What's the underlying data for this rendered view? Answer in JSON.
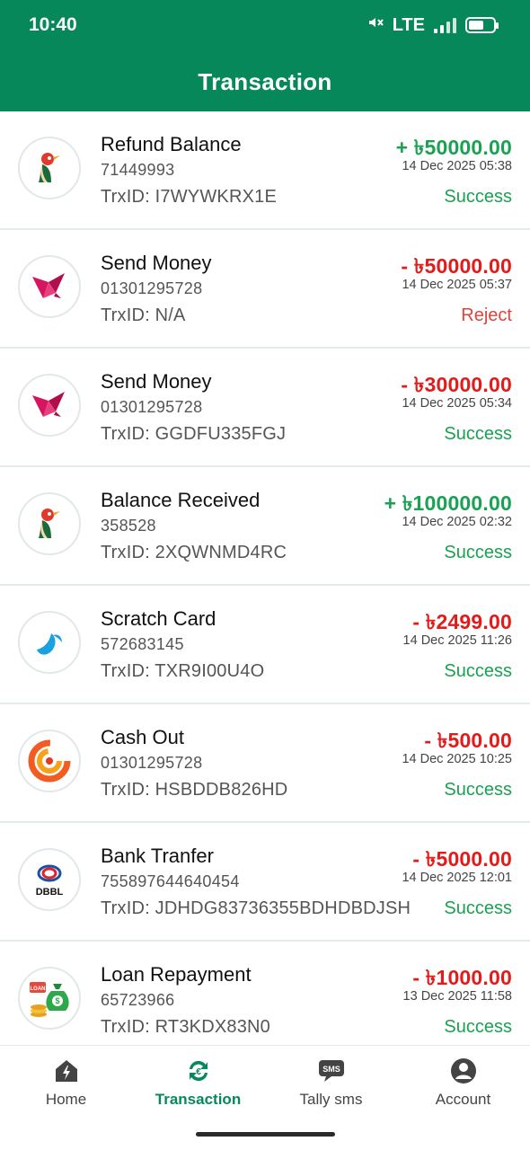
{
  "status_bar": {
    "time": "10:40",
    "network": "LTE"
  },
  "header": {
    "title": "Transaction"
  },
  "transactions": [
    {
      "title": "Refund Balance",
      "number": "71449993",
      "trx_id": "TrxID: I7WYWKRX1E",
      "amount": "+ ৳50000.00",
      "type": "credit",
      "date": "14 Dec 2025 05:38",
      "status": "Success",
      "status_type": "ok",
      "icon": "robi-bird-icon"
    },
    {
      "title": "Send Money",
      "number": "01301295728",
      "trx_id": "TrxID: N/A",
      "amount": "- ৳50000.00",
      "type": "debit",
      "date": "14 Dec 2025 05:37",
      "status": "Reject",
      "status_type": "bad",
      "icon": "bkash-bird-icon"
    },
    {
      "title": "Send Money",
      "number": "01301295728",
      "trx_id": "TrxID: GGDFU335FGJ",
      "amount": "- ৳30000.00",
      "type": "debit",
      "date": "14 Dec 2025 05:34",
      "status": "Success",
      "status_type": "ok",
      "icon": "bkash-bird-icon"
    },
    {
      "title": "Balance Received",
      "number": "358528",
      "trx_id": "TrxID: 2XQWNMD4RC",
      "amount": "+ ৳100000.00",
      "type": "credit",
      "date": "14 Dec 2025 02:32",
      "status": "Success",
      "status_type": "ok",
      "icon": "robi-bird-icon"
    },
    {
      "title": "Scratch Card",
      "number": "572683145",
      "trx_id": "TrxID: TXR9I00U4O",
      "amount": "- ৳2499.00",
      "type": "debit",
      "date": "14 Dec 2025 11:26",
      "status": "Success",
      "status_type": "ok",
      "icon": "grameenphone-icon"
    },
    {
      "title": "Cash Out",
      "number": "01301295728",
      "trx_id": "TrxID: HSBDDB826HD",
      "amount": "- ৳500.00",
      "type": "debit",
      "date": "14 Dec 2025 10:25",
      "status": "Success",
      "status_type": "ok",
      "icon": "nagad-icon"
    },
    {
      "title": "Bank Tranfer",
      "number": "755897644640454",
      "trx_id": "TrxID: JDHDG83736355BDHDBDJSH",
      "amount": "- ৳5000.00",
      "type": "debit",
      "date": "14 Dec 2025 12:01",
      "status": "Success",
      "status_type": "ok",
      "icon": "dbbl-bank-icon",
      "icon_text": "DBBL"
    },
    {
      "title": "Loan Repayment",
      "number": "65723966",
      "trx_id": "TrxID: RT3KDX83N0",
      "amount": "- ৳1000.00",
      "type": "debit",
      "date": "13 Dec 2025 11:58",
      "status": "Success",
      "status_type": "ok",
      "icon": "money-bag-icon",
      "icon_text": "LOAN"
    }
  ],
  "bottom_nav": [
    {
      "label": "Home",
      "icon": "home-icon",
      "active": false
    },
    {
      "label": "Transaction",
      "icon": "transaction-icon",
      "active": true
    },
    {
      "label": "Tally sms",
      "icon": "sms-icon",
      "icon_text": "SMS",
      "active": false
    },
    {
      "label": "Account",
      "icon": "account-icon",
      "active": false
    }
  ],
  "colors": {
    "brand": "#07885a",
    "credit": "#1aa152",
    "debit": "#e21b1b",
    "reject": "#e0433b"
  }
}
